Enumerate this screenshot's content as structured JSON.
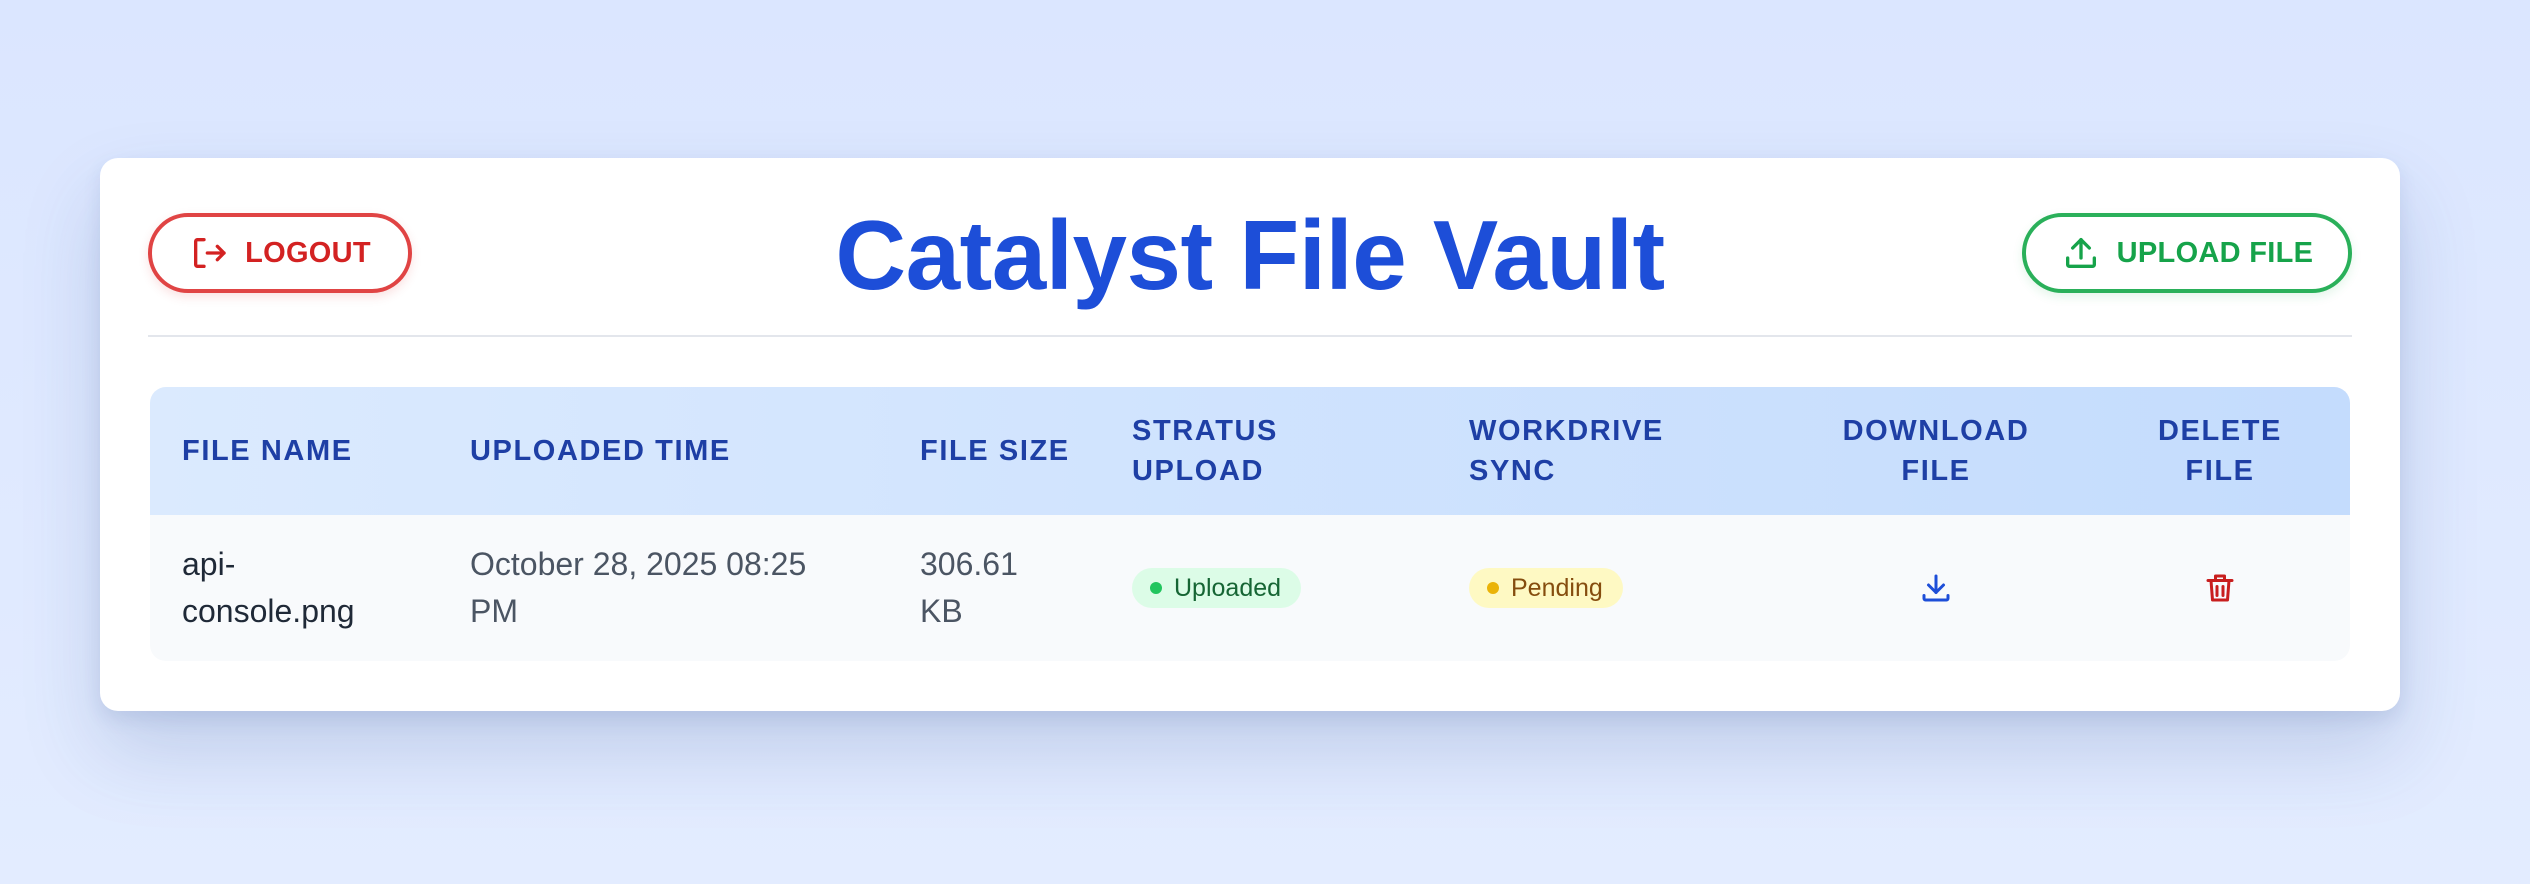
{
  "header": {
    "title": "Catalyst File Vault",
    "logout_label": "LOGOUT",
    "upload_label": "UPLOAD FILE"
  },
  "table": {
    "columns": [
      {
        "line1": "FILE NAME",
        "line2": ""
      },
      {
        "line1": "UPLOADED TIME",
        "line2": ""
      },
      {
        "line1": "FILE SIZE",
        "line2": ""
      },
      {
        "line1": "STRATUS",
        "line2": "UPLOAD"
      },
      {
        "line1": "WORKDRIVE",
        "line2": "SYNC"
      },
      {
        "line1": "DOWNLOAD",
        "line2": "FILE"
      },
      {
        "line1": "DELETE",
        "line2": "FILE"
      }
    ],
    "rows": [
      {
        "file_name_line1": "api-",
        "file_name_line2": "console.png",
        "uploaded_line1": "October 28, 2025 08:25",
        "uploaded_line2": "PM",
        "size_line1": "306.61",
        "size_line2": "KB",
        "stratus_status": "Uploaded",
        "workdrive_status": "Pending"
      }
    ]
  },
  "icons": {
    "logout": "logout-icon",
    "upload": "upload-icon",
    "download": "download-icon",
    "delete": "trash-icon"
  },
  "colors": {
    "title": "#1d4ed8",
    "logout": "#d32222",
    "upload": "#16a34a",
    "header_text": "#1e3fa5",
    "uploaded_badge": "#dcfce7",
    "pending_badge": "#fef9c3",
    "download_icon": "#1d4ed8",
    "delete_icon": "#c81e1e"
  }
}
